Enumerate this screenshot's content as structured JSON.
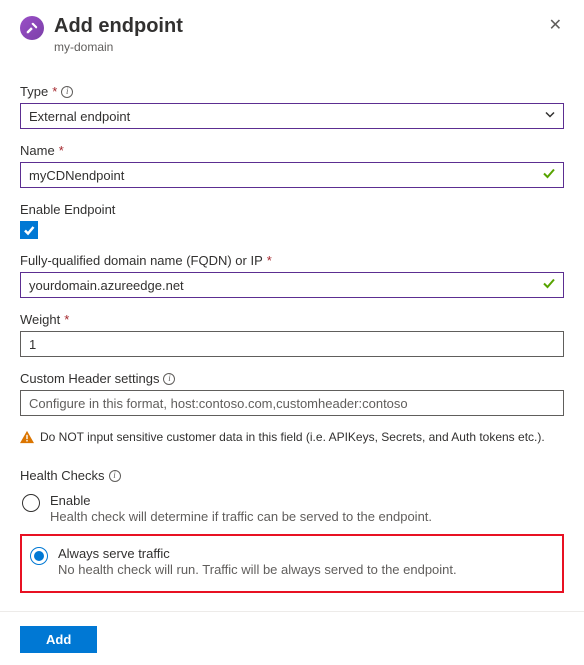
{
  "header": {
    "title": "Add endpoint",
    "subtitle": "my-domain"
  },
  "fields": {
    "type": {
      "label": "Type",
      "value": "External endpoint"
    },
    "name": {
      "label": "Name",
      "value": "myCDNendpoint"
    },
    "enable": {
      "label": "Enable Endpoint",
      "checked": true
    },
    "fqdn": {
      "label": "Fully-qualified domain name (FQDN) or IP",
      "value": "yourdomain.azureedge.net"
    },
    "weight": {
      "label": "Weight",
      "value": "1"
    },
    "customHeader": {
      "label": "Custom Header settings",
      "placeholder": "Configure in this format, host:contoso.com,customheader:contoso"
    }
  },
  "warning": "Do NOT input sensitive customer data in this field (i.e. APIKeys, Secrets, and Auth tokens etc.).",
  "healthChecks": {
    "label": "Health Checks",
    "options": {
      "enable": {
        "title": "Enable",
        "desc": "Health check will determine if traffic can be served to the endpoint."
      },
      "always": {
        "title": "Always serve traffic",
        "desc": "No health check will run. Traffic will be always served to the endpoint."
      }
    }
  },
  "footer": {
    "addLabel": "Add"
  }
}
